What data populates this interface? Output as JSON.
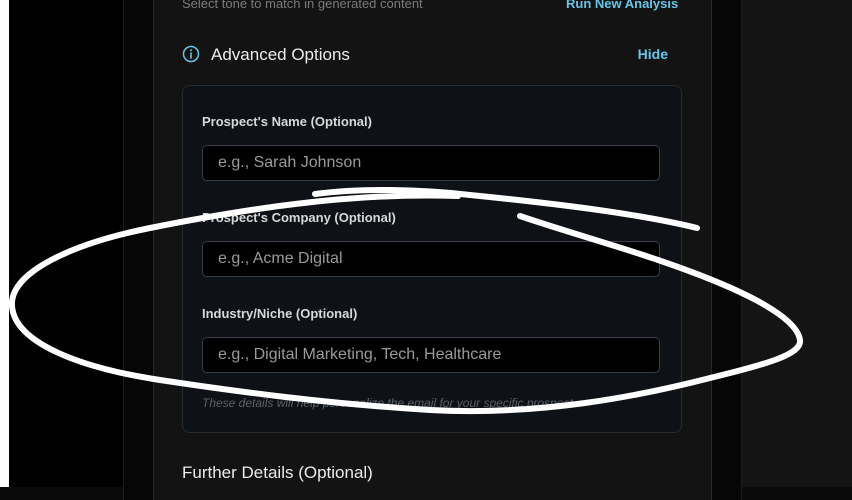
{
  "tone_hint": "Select tone to match in generated content",
  "run_analysis_label": "Run New Analysis",
  "advanced": {
    "title": "Advanced Options",
    "toggle_label": "Hide",
    "icon": "info-circle-icon"
  },
  "fields": {
    "prospect_name": {
      "label": "Prospect's Name (Optional)",
      "placeholder": "e.g., Sarah Johnson",
      "value": ""
    },
    "prospect_company": {
      "label": "Prospect's Company (Optional)",
      "placeholder": "e.g., Acme Digital",
      "value": ""
    },
    "industry": {
      "label": "Industry/Niche (Optional)",
      "placeholder": "e.g., Digital Marketing, Tech, Healthcare",
      "value": ""
    }
  },
  "helper_text": "These details will help personalize the email for your specific prospect",
  "further_details_title": "Further Details (Optional)",
  "colors": {
    "accent": "#67c6e8",
    "panel": "#0e1116",
    "card": "#131313",
    "annotation": "#ffffff"
  }
}
